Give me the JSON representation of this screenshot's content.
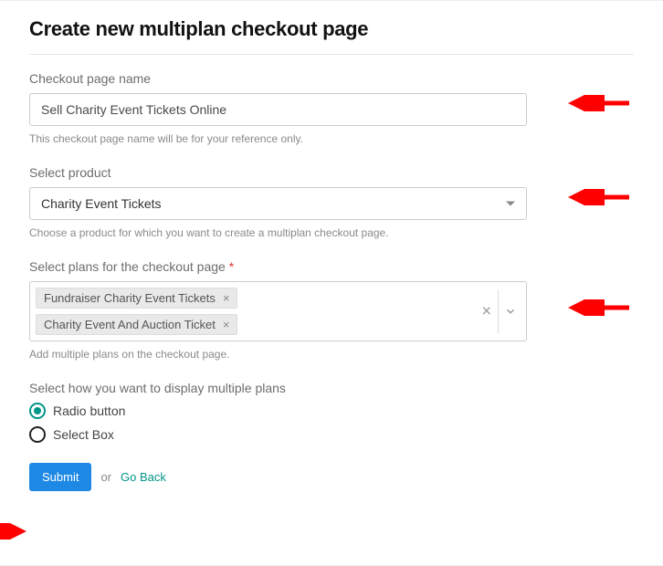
{
  "page": {
    "title": "Create new multiplan checkout page"
  },
  "name_field": {
    "label": "Checkout page name",
    "value": "Sell Charity Event Tickets Online",
    "helper": "This checkout page name will be for your reference only."
  },
  "product_field": {
    "label": "Select product",
    "value": "Charity Event Tickets",
    "helper": "Choose a product for which you want to create a multiplan checkout page."
  },
  "plans_field": {
    "label": "Select plans for the checkout page",
    "required_mark": "*",
    "chips": [
      "Fundraiser Charity Event Tickets",
      "Charity Event And Auction Ticket"
    ],
    "helper": "Add multiple plans on the checkout page."
  },
  "display_field": {
    "label": "Select how you want to display multiple plans",
    "options": [
      "Radio button",
      "Select Box"
    ],
    "selected": "Radio button"
  },
  "actions": {
    "submit": "Submit",
    "or": "or",
    "goback": "Go Back"
  },
  "colors": {
    "accent": "#029688",
    "primary_btn": "#1e88e5",
    "annotation": "#ff0000"
  }
}
